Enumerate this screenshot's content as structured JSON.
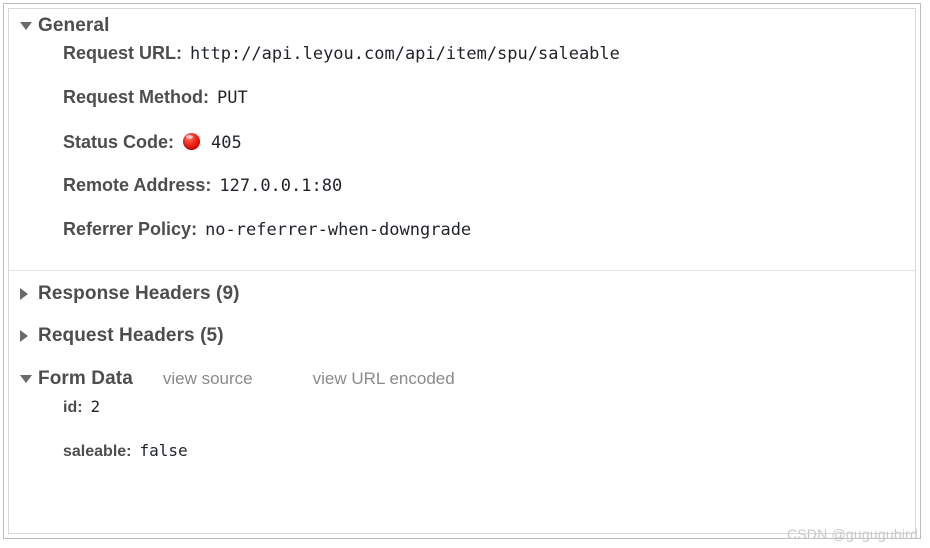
{
  "panel": {
    "general": {
      "title": "General",
      "expanded_icon": "triangle-down-icon",
      "rows": [
        {
          "key": "Request URL:",
          "value": "http://api.leyou.com/api/item/spu/saleable"
        },
        {
          "key": "Request Method:",
          "value": "PUT"
        },
        {
          "key": "Status Code:",
          "value": "405",
          "status_icon": "red-circle-icon",
          "status_color": "#e5201a"
        },
        {
          "key": "Remote Address:",
          "value": "127.0.0.1:80"
        },
        {
          "key": "Referrer Policy:",
          "value": "no-referrer-when-downgrade"
        }
      ]
    },
    "collapsed_sections": [
      {
        "title": "Response Headers (9)",
        "collapsed_icon": "triangle-right-icon"
      },
      {
        "title": "Request Headers (5)",
        "collapsed_icon": "triangle-right-icon"
      }
    ],
    "form_data": {
      "title": "Form Data",
      "expanded_icon": "triangle-down-icon",
      "view_source_label": "view source",
      "view_url_encoded_label": "view URL encoded",
      "rows": [
        {
          "key": "id:",
          "value": "2"
        },
        {
          "key": "saleable:",
          "value": "false"
        }
      ]
    }
  },
  "watermark": "CSDN @gugugubird",
  "colors": {
    "label_text": "#4d4d4d",
    "value_text": "#1f2328",
    "link_text": "#8a8a8a",
    "border": "#bdbdbd",
    "divider": "#e3e3e3",
    "watermark": "#c8c8c8"
  }
}
